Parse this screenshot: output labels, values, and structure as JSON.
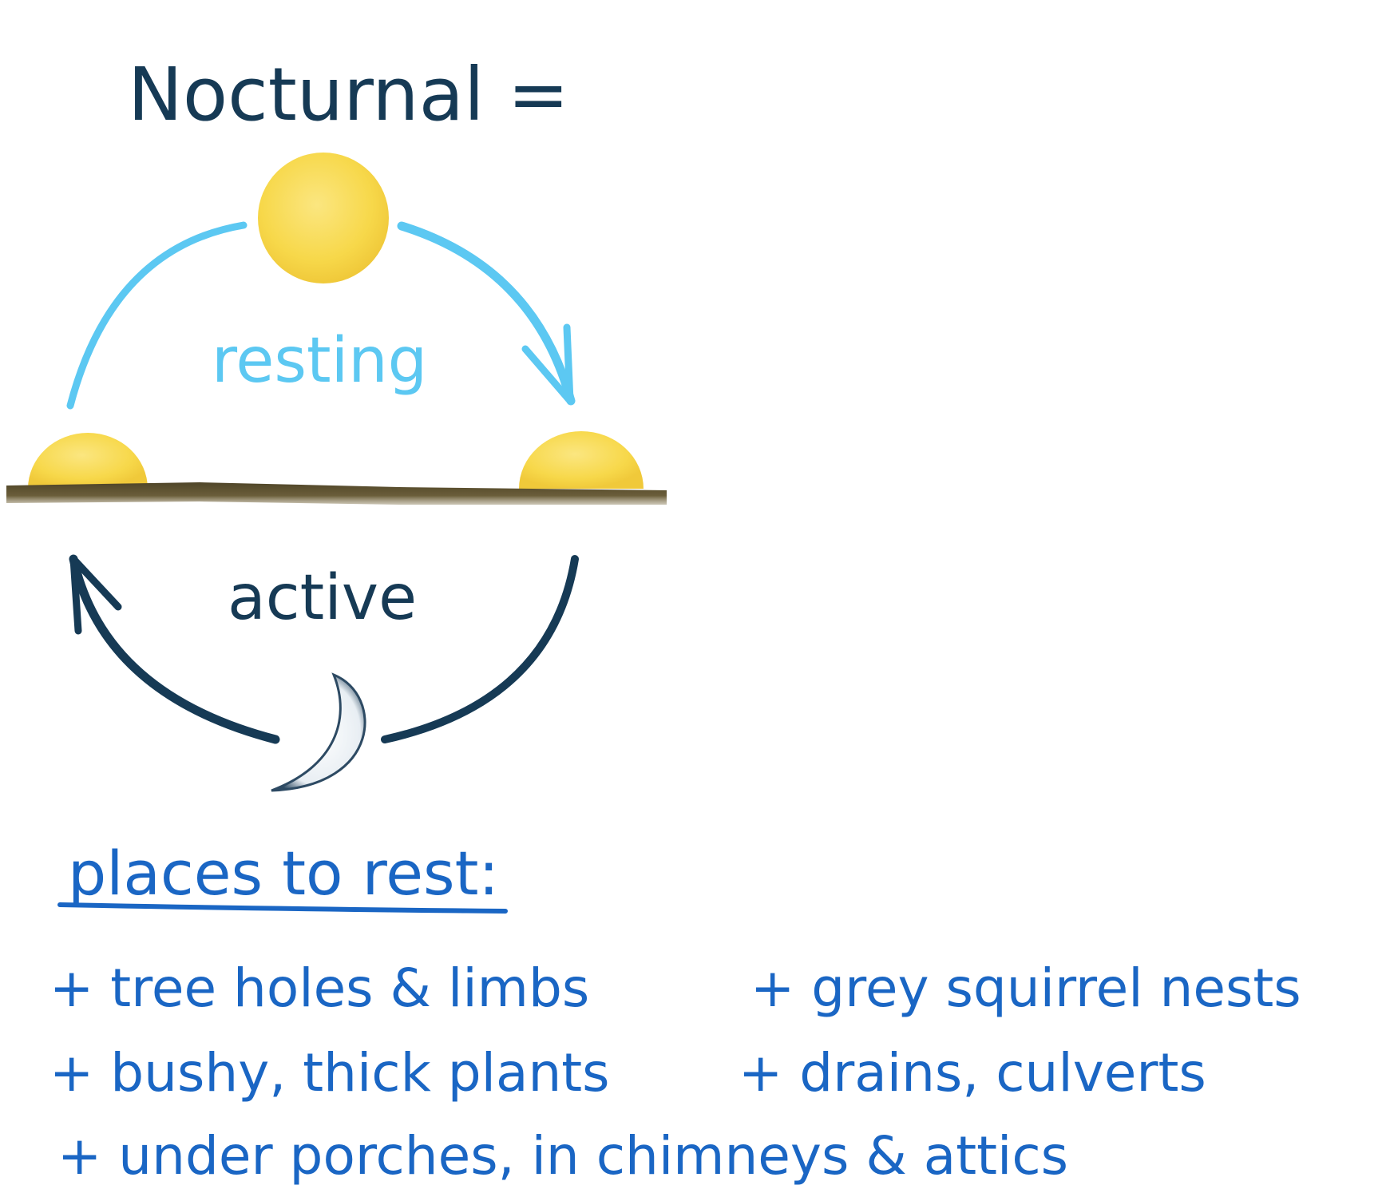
{
  "title": "Nocturnal =",
  "cycle": {
    "day_label": "resting",
    "night_label": "active",
    "day_arrow_color": "#5cc8f2",
    "night_arrow_color": "#163a55",
    "sun_color": "#f7d84a",
    "ground_color": "#6b5e3a",
    "icons": [
      "sun-icon",
      "moon-icon"
    ]
  },
  "places": {
    "heading": "places to rest:",
    "items": [
      "+ tree holes & limbs",
      "+ grey squirrel nests",
      "+ bushy, thick plants",
      "+ drains, culverts",
      "+ under porches, in chimneys & attics"
    ]
  },
  "colors": {
    "title": "#163a55",
    "list": "#1a66c4"
  }
}
